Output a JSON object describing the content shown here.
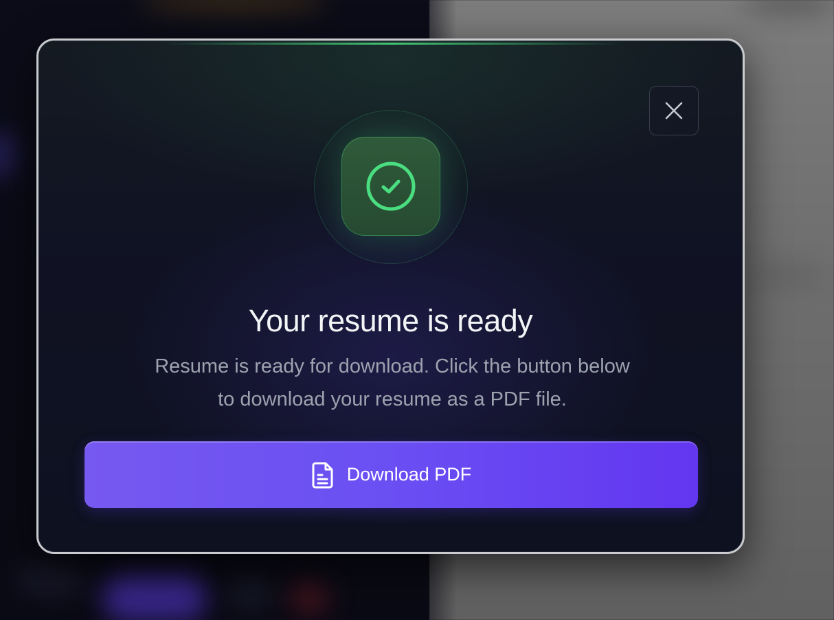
{
  "dialog": {
    "title": "Your resume is ready",
    "description_line1": "Resume is ready for download. Click the button below",
    "description_line2": "to download your resume as a PDF file.",
    "download_button_label": "Download PDF",
    "icons": {
      "status": "check-circle-icon",
      "close": "close-icon",
      "download": "file-text-icon"
    },
    "colors": {
      "accent_green": "#4ade80",
      "button_purple": "#6a4ff3"
    }
  }
}
